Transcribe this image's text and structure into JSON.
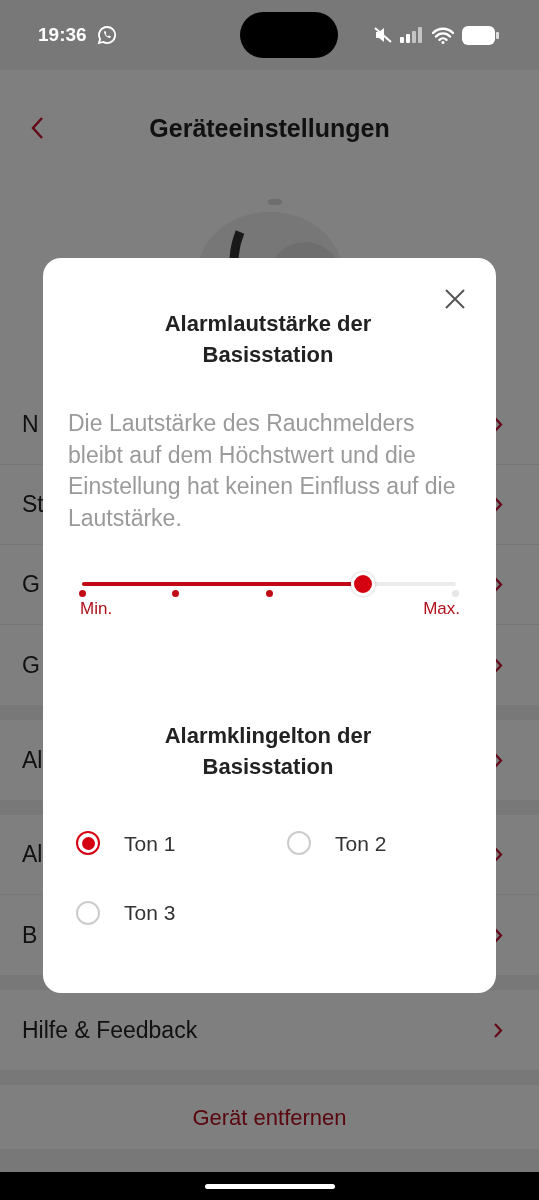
{
  "status_bar": {
    "time": "19:36"
  },
  "header": {
    "title": "Geräteeinstellungen"
  },
  "sections": [
    {
      "items": [
        {
          "label": "N"
        },
        {
          "label": "St"
        },
        {
          "label": "G"
        },
        {
          "label": "G"
        }
      ]
    },
    {
      "items": [
        {
          "label": "Al"
        }
      ]
    },
    {
      "items": [
        {
          "label": "Al"
        },
        {
          "label": "B"
        }
      ]
    },
    {
      "items": [
        {
          "label": "Hilfe & Feedback"
        }
      ]
    }
  ],
  "remove_button": {
    "label": "Gerät entfernen"
  },
  "dialog": {
    "title": "Alarmlautstärke der Basisstation",
    "description": "Die Lautstärke des Rauchmelders bleibt auf dem Höchstwert und die Einstellung hat keinen Einfluss auf die Lautstärke.",
    "volume": {
      "level": 0.75,
      "min_label": "Min.",
      "max_label": "Max."
    },
    "ringtone_title": "Alarmklingelton der Basisstation",
    "ringtones": [
      {
        "label": "Ton 1",
        "selected": true
      },
      {
        "label": "Ton 2",
        "selected": false
      },
      {
        "label": "Ton 3",
        "selected": false
      }
    ]
  }
}
